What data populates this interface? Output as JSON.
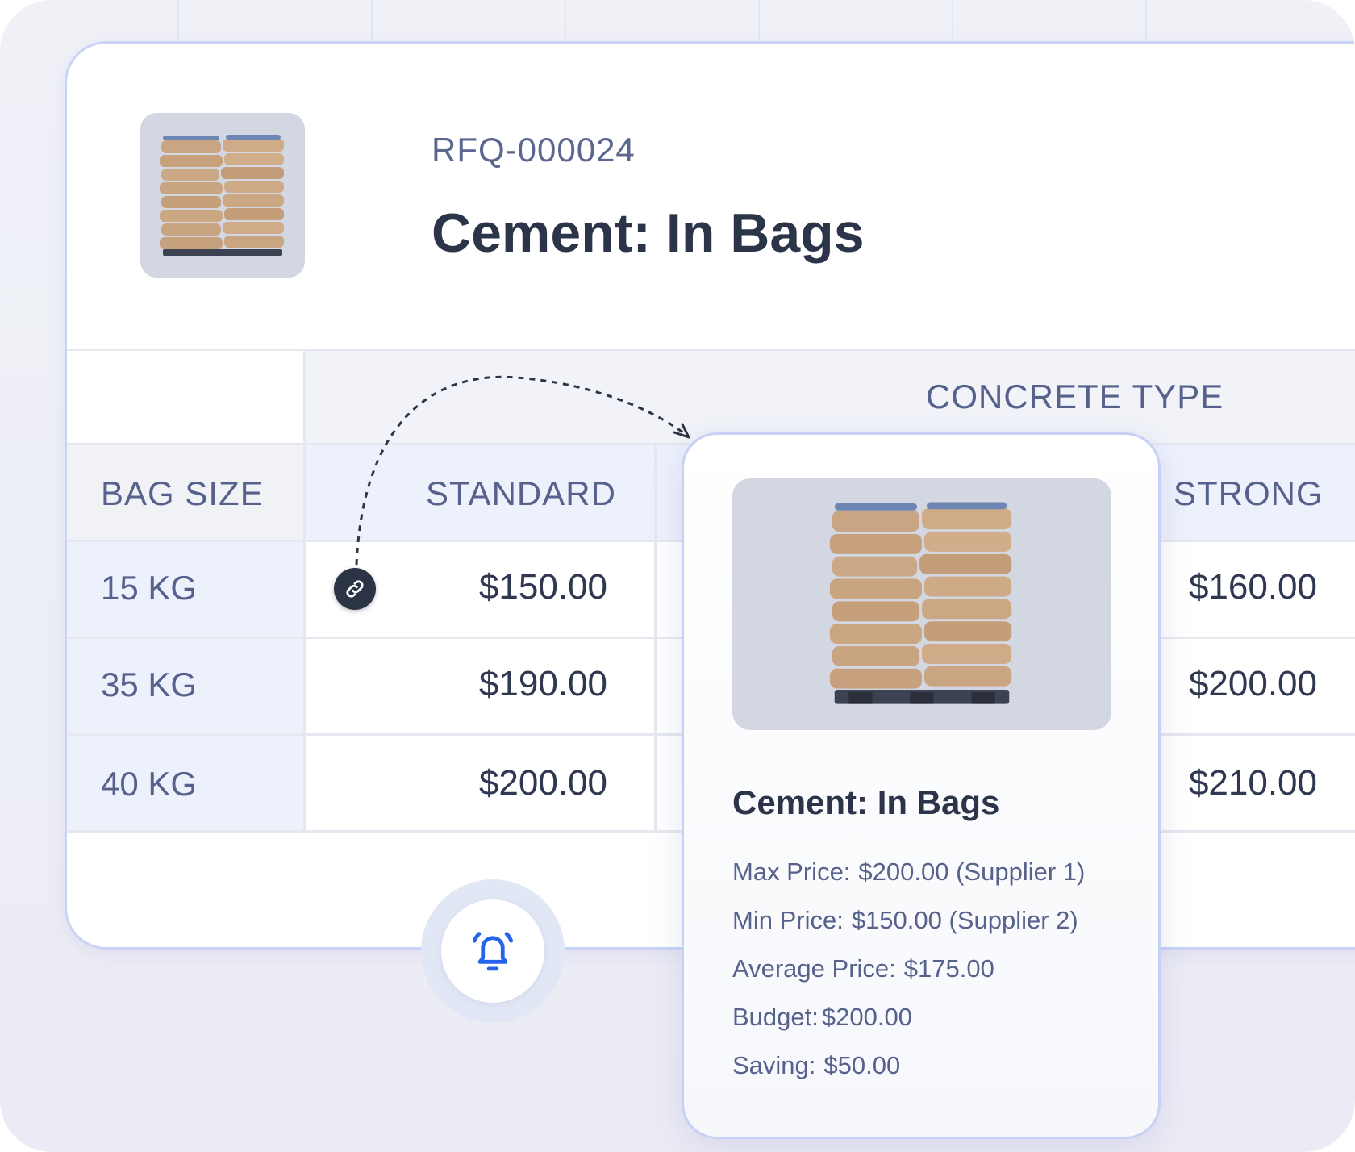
{
  "rfq": {
    "id": "RFQ-000024",
    "title": "Cement: In Bags",
    "thumbnail_icon": "cement-bags-image"
  },
  "table": {
    "group_header": "CONCRETE TYPE",
    "bag_size_header": "BAG SIZE",
    "columns": [
      "STANDARD",
      "STRONG"
    ],
    "rows": [
      {
        "size": "15 KG",
        "standard": "$150.00",
        "strong": "$160.00"
      },
      {
        "size": "35 KG",
        "standard": "$190.00",
        "strong": "$200.00"
      },
      {
        "size": "40 KG",
        "standard": "$200.00",
        "strong": "$210.00"
      }
    ]
  },
  "popup": {
    "title": "Cement: In Bags",
    "image_icon": "cement-bags-image",
    "stats": [
      {
        "label": "Max Price:",
        "value": "$200.00 (Supplier 1)"
      },
      {
        "label": "Min Price:",
        "value": "$150.00 (Supplier 2)"
      },
      {
        "label": "Average Price:",
        "value": "$175.00"
      },
      {
        "label": "Budget:",
        "value": "$200.00"
      },
      {
        "label": "Saving:",
        "value": "$50.00"
      }
    ]
  },
  "icons": {
    "link": "link-icon",
    "bell": "bell-icon"
  },
  "colors": {
    "accent_blue": "#2563eb",
    "text_dark": "#2c3449",
    "text_muted": "#56628c",
    "header_bg": "#edf1fc"
  }
}
